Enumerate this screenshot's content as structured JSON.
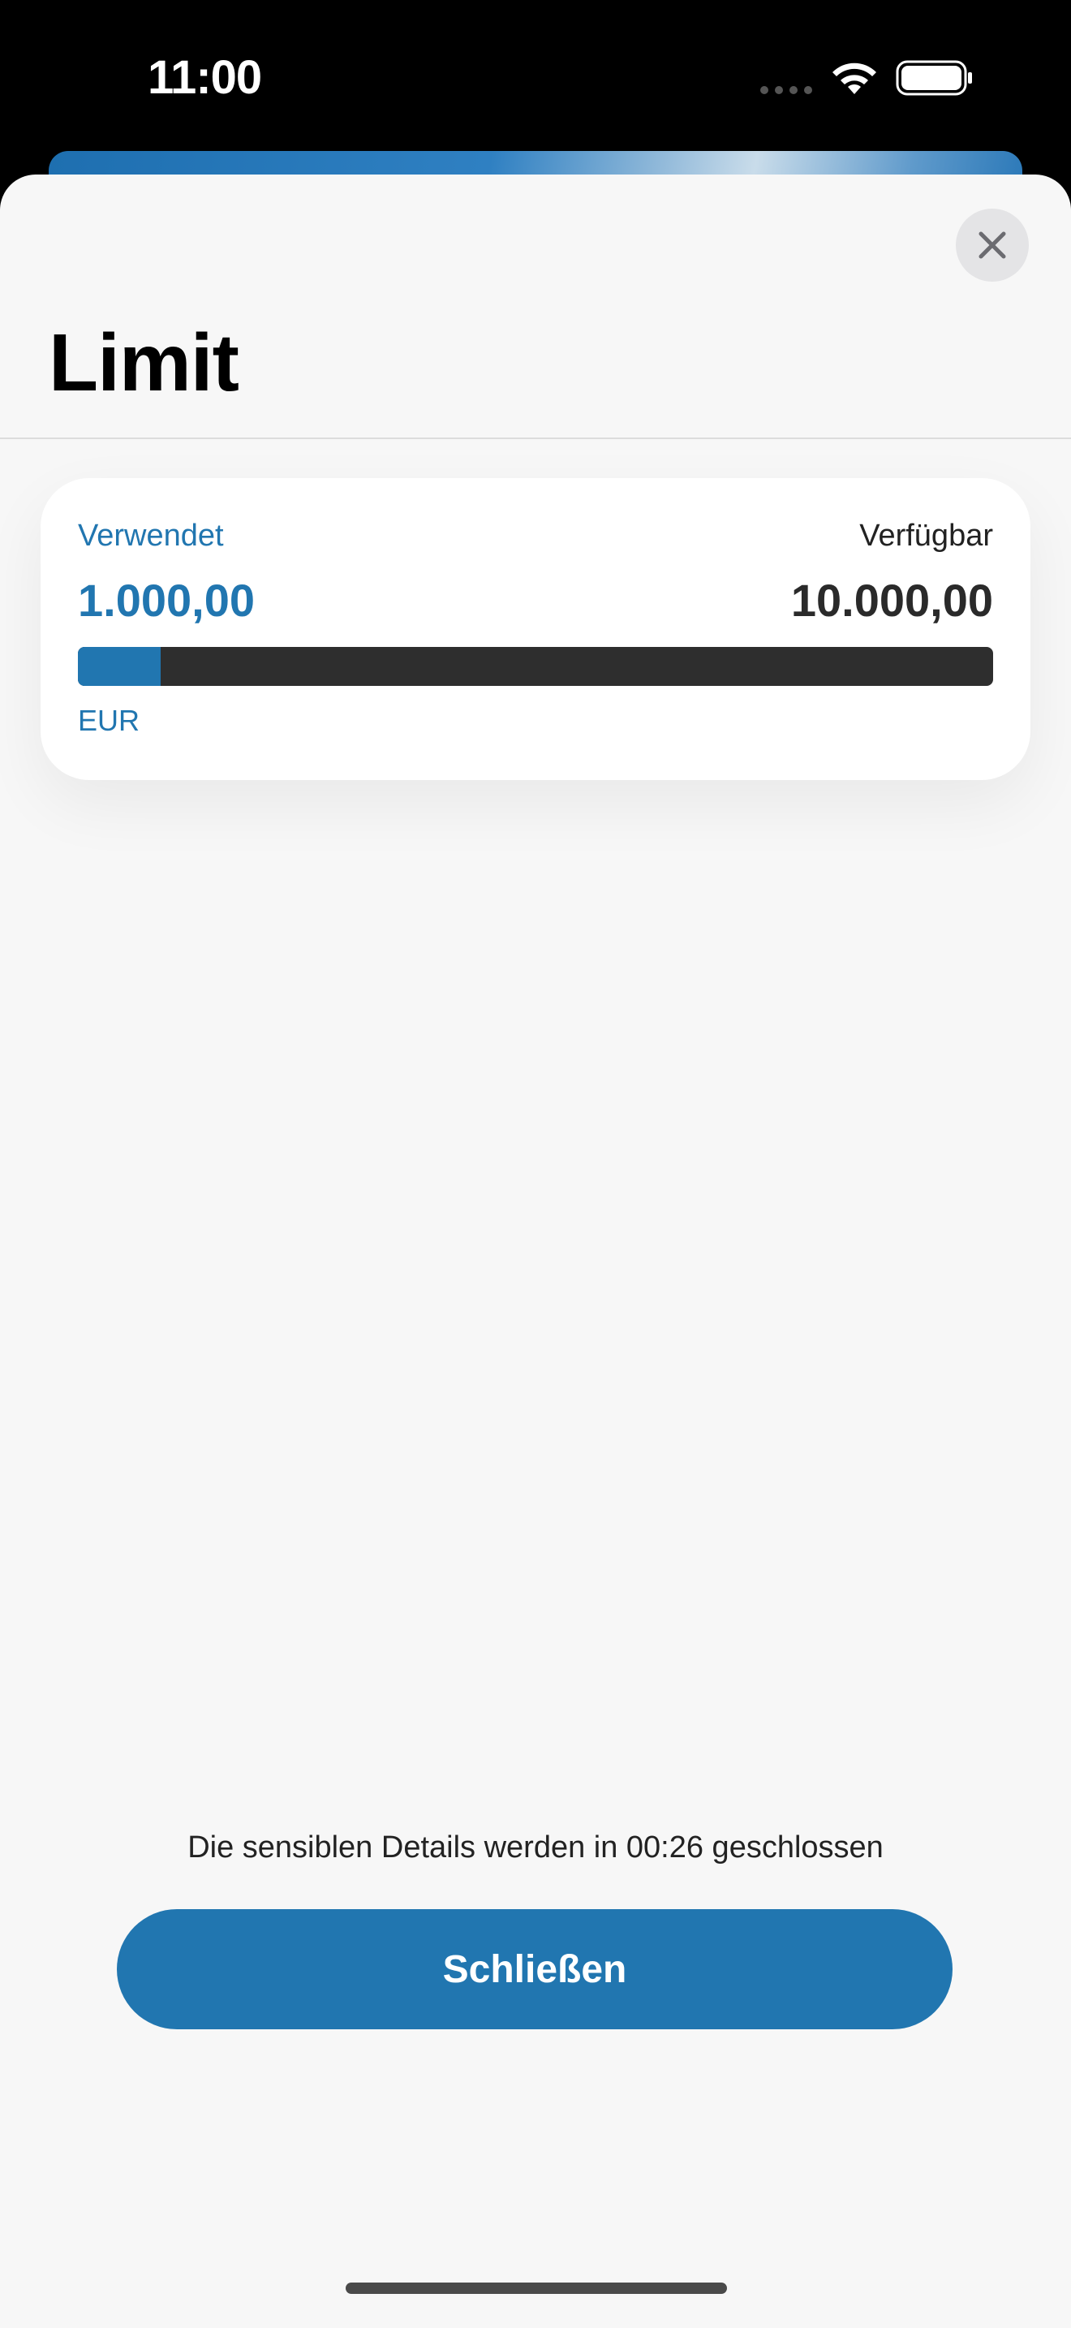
{
  "status_bar": {
    "time": "11:00",
    "icons": [
      "signal-dots-icon",
      "wifi-icon",
      "battery-icon"
    ]
  },
  "sheet": {
    "title": "Limit",
    "close_icon": "close-icon"
  },
  "limit_card": {
    "used_label": "Verwendet",
    "available_label": "Verfügbar",
    "used_value": "1.000,00",
    "available_value": "10.000,00",
    "currency": "EUR",
    "used_fraction": 0.09
  },
  "footer": {
    "countdown_text": "Die sensiblen Details werden in 00:26 geschlossen",
    "close_button_label": "Schließen"
  },
  "colors": {
    "accent": "#2176b0",
    "track": "#2e2e2e",
    "sheet_background": "#f7f7f7"
  }
}
